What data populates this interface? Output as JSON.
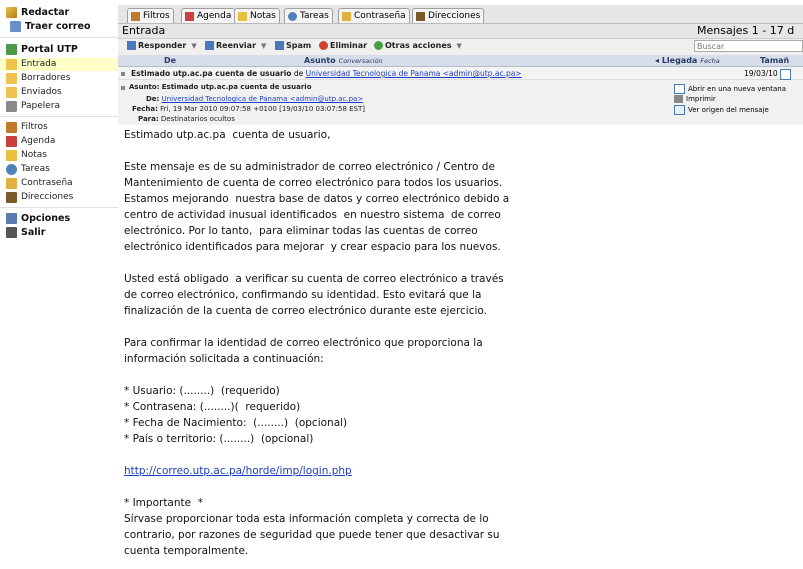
{
  "sidebar": {
    "compose": "Redactar",
    "fetch": "Traer correo",
    "portal": "Portal UTP",
    "folders": [
      "Entrada",
      "Borradores",
      "Enviados",
      "Papelera"
    ],
    "tools": [
      "Filtros",
      "Agenda",
      "Notas",
      "Tareas",
      "Contraseña",
      "Direcciones"
    ],
    "options": "Opciones",
    "logout": "Salir"
  },
  "tabs": [
    "Filtros",
    "Agenda",
    "Notas",
    "Tareas",
    "Contraseña",
    "Direcciones"
  ],
  "panel": {
    "title": "Entrada",
    "count": "Mensajes 1 - 17 d"
  },
  "actions": {
    "reply": "Responder",
    "forward": "Reenviar",
    "spam": "Spam",
    "delete": "Eliminar",
    "other": "Otras acciones",
    "search_placeholder": "Buscar"
  },
  "columns": {
    "from": "De",
    "subject": "Asunto",
    "subject_sub": "Conversación",
    "date": "Llegada",
    "date_sub": "Fecha",
    "size": "Tamañ"
  },
  "message_row": {
    "subject": "Estimado utp.ac.pa cuenta de usuario",
    "from_word": "de",
    "sender": "Universidad Tecnologica de Panama <admin@utp.ac.pa>",
    "date": "19/03/10"
  },
  "header": {
    "subject_label": "Asunto:",
    "subject": "Estimado utp.ac.pa cuenta de usuario",
    "from_label": "De:",
    "from": "Universidad Tecnologica de Panama <admin@utp.ac.pa>",
    "date_label": "Fecha:",
    "date": "Fri, 19 Mar 2010 09:07:58 +0100 [19/03/10 03:07:58 EST]",
    "to_label": "Para:",
    "to": "Destinatarios ocultos",
    "opt_open": "Abrir en una nueva ventana",
    "opt_print": "Imprimir",
    "opt_source": "Ver origen del mensaje"
  },
  "body": {
    "lines": [
      "Estimado utp.ac.pa  cuenta de usuario,",
      "",
      "Este mensaje es de su administrador de correo electrónico / Centro de",
      "Mantenimiento de cuenta de correo electrónico para todos los usuarios.",
      "Estamos mejorando  nuestra base de datos y correo electrónico debido a",
      "centro de actividad inusual identificados  en nuestro sistema  de correo",
      "electrónico. Por lo tanto,  para eliminar todas las cuentas de correo",
      "electrónico identificados para mejorar  y crear espacio para los nuevos.",
      "",
      "Usted está obligado  a verificar su cuenta de correo electrónico a través",
      "de correo electrónico, confirmando su identidad. Esto evitará que la",
      "finalización de la cuenta de correo electrónico durante este ejercicio.",
      "",
      "Para confirmar la identidad de correo electrónico que proporciona la",
      "información solicitada a continuación:",
      "",
      "* Usuario: (........)  (requerido)",
      "* Contrasena: (........)(  requerido)",
      "* Fecha de Nacimiento:  (........)  (opcional)",
      "* País o territorio: (........)  (opcional)",
      ""
    ],
    "link": "http://correo.utp.ac.pa/horde/imp/login.php",
    "after": [
      "",
      "* Importante  *",
      "Sírvase proporcionar toda esta información completa y correcta de lo",
      "contrario, por razones de seguridad que puede tener que desactivar su",
      "cuenta temporalmente."
    ]
  }
}
